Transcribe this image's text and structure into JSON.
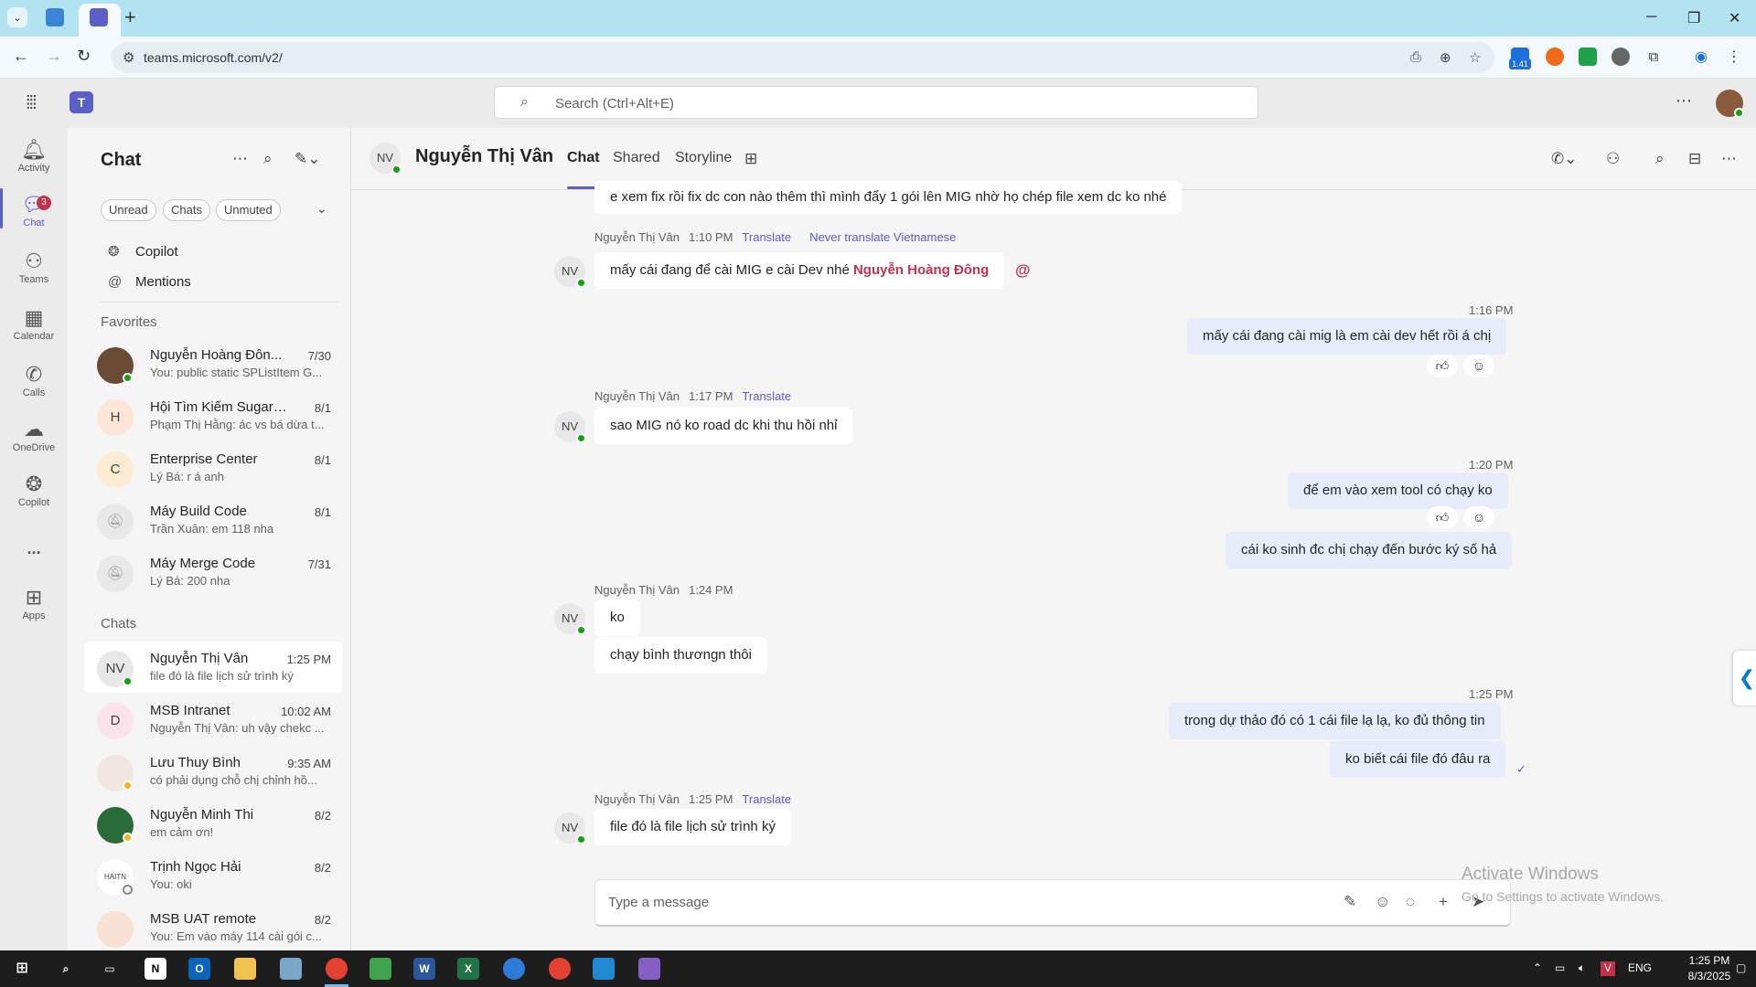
{
  "browser": {
    "url": "teams.microsoft.com/v2/",
    "extension_badge": "1.41"
  },
  "teams": {
    "search_placeholder": "Search (Ctrl+Alt+E)"
  },
  "rail": {
    "items": [
      {
        "label": "Activity",
        "icon": "bell-icon"
      },
      {
        "label": "Chat",
        "icon": "chat-icon",
        "badge": "3"
      },
      {
        "label": "Teams",
        "icon": "teams-icon"
      },
      {
        "label": "Calendar",
        "icon": "calendar-icon"
      },
      {
        "label": "Calls",
        "icon": "phone-icon"
      },
      {
        "label": "OneDrive",
        "icon": "cloud-icon"
      },
      {
        "label": "Copilot",
        "icon": "copilot-icon"
      },
      {
        "label": "...",
        "icon": "more-icon"
      },
      {
        "label": "Apps",
        "icon": "plus-box-icon"
      }
    ]
  },
  "chatlist": {
    "title": "Chat",
    "filters": [
      "Unread",
      "Chats",
      "Unmuted"
    ],
    "nav": [
      {
        "label": "Copilot",
        "icon": "copilot-icon"
      },
      {
        "label": "Mentions",
        "icon": "at-icon"
      }
    ],
    "favorites_header": "Favorites",
    "favorites": [
      {
        "name": "Nguyễn Hoàng Đôn...",
        "time": "7/30",
        "preview": "You: public static SPListItem G...",
        "avatar": "",
        "status": "online"
      },
      {
        "name": "Hội Tìm Kiếm Sugar ...",
        "time": "8/1",
        "preview": "Phạm Thị Hằng: ác vs bá dừa t...",
        "avatar": "H",
        "status": ""
      },
      {
        "name": "Enterprise Center",
        "time": "8/1",
        "preview": "Lý Bá: r á anh",
        "avatar": "C",
        "status": ""
      },
      {
        "name": "Máy Build Code",
        "time": "8/1",
        "preview": "Trần Xuân: em 118 nha",
        "avatar": "muted",
        "status": ""
      },
      {
        "name": "Máy Merge Code",
        "time": "7/31",
        "preview": "Lý Bá: 200 nha",
        "avatar": "muted",
        "status": ""
      }
    ],
    "chats_header": "Chats",
    "chats": [
      {
        "name": "Nguyễn Thị Vân",
        "time": "1:25 PM",
        "preview": "file đó là file lịch sử trình ký",
        "avatar": "NV",
        "status": "online"
      },
      {
        "name": "MSB Intranet",
        "time": "10:02 AM",
        "preview": "Nguyễn Thị Vân: uh vậy chekc ...",
        "avatar": "D",
        "status": ""
      },
      {
        "name": "Lưu Thuy Bình",
        "time": "9:35 AM",
        "preview": "có phải dụng chỗ chị chỉnh hồ...",
        "avatar": "",
        "status": "away"
      },
      {
        "name": "Nguyễn Minh Thi",
        "time": "8/2",
        "preview": "em cảm ơn!",
        "avatar": "",
        "status": "away"
      },
      {
        "name": "Trịnh Ngọc Hải",
        "time": "8/2",
        "preview": "You: oki",
        "avatar": "HAITN",
        "status": "off"
      },
      {
        "name": "MSB UAT remote",
        "time": "8/2",
        "preview": "You: Em vào máy 114 cài gói c...",
        "avatar": "",
        "status": ""
      }
    ]
  },
  "conversation": {
    "avatar": "NV",
    "name": "Nguyễn Thị Vân",
    "tabs": [
      "Chat",
      "Shared",
      "Storyline"
    ],
    "messages": {
      "m0": {
        "text": "e xem fix rồi fix dc con nào thêm thì mình đẩy 1 gói lên MIG nhờ họ chép file xem dc ko nhé"
      },
      "m1": {
        "sender": "Nguyễn Thị Vân",
        "time": "1:10 PM",
        "translate": "Translate",
        "never": "Never translate Vietnamese",
        "text": "mấy cái đang để cài MIG e cài Dev nhé",
        "mention": "Nguyễn Hoàng Đông",
        "at": "@"
      },
      "o1": {
        "time": "1:16 PM",
        "text": "mấy cái đang cài mig là em cài dev hết rồi á chị"
      },
      "m2": {
        "sender": "Nguyễn Thị Vân",
        "time": "1:17 PM",
        "translate": "Translate",
        "text": "sao MIG nó ko road dc khi thu hồi nhỉ"
      },
      "o2": {
        "time": "1:20 PM",
        "text1": "để em vào xem tool có chạy ko",
        "text2": "cái ko sinh đc chị chạy đến bước ký số hả"
      },
      "m3": {
        "sender": "Nguyễn Thị Vân",
        "time": "1:24 PM",
        "text1": "ko",
        "text2": "chạy bình thươngn thôi"
      },
      "o3": {
        "time": "1:25 PM",
        "text1": "trong dự thảo đó có 1 cái file lạ lạ, ko đủ thông tin",
        "text2": "ko biết cái file đó đâu ra"
      },
      "m4": {
        "sender": "Nguyễn Thị Vân",
        "time": "1:25 PM",
        "translate": "Translate",
        "text": "file đó là file lịch sử trình ký"
      }
    },
    "compose_placeholder": "Type a message"
  },
  "watermark": {
    "line1": "Activate Windows",
    "line2": "Go to Settings to activate Windows."
  },
  "taskbar": {
    "lang": "ENG",
    "time": "1:25 PM",
    "date": "8/3/2025"
  }
}
